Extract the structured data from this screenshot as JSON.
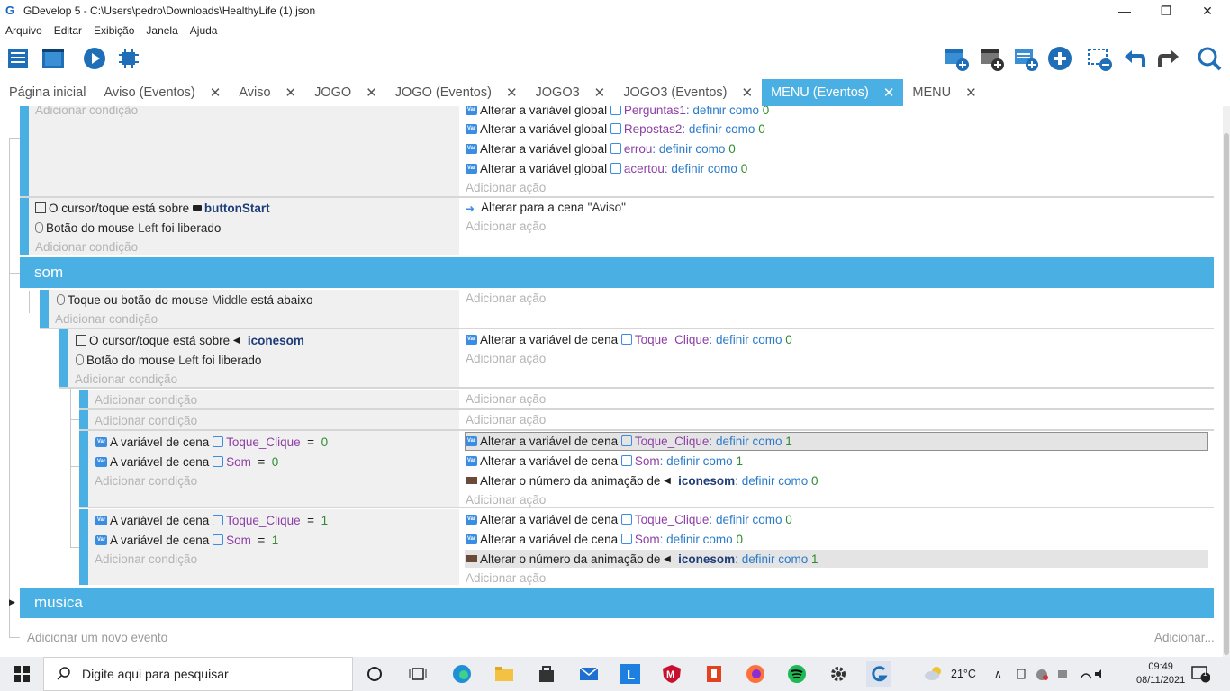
{
  "window": {
    "title": "GDevelop 5 - C:\\Users\\pedro\\Downloads\\HealthyLife (1).json",
    "minimize_glyph": "—",
    "restore_glyph": "❐",
    "close_glyph": "✕"
  },
  "menu": [
    "Arquivo",
    "Editar",
    "Exibição",
    "Janela",
    "Ajuda"
  ],
  "toolbar": {
    "icons": [
      "project-manager-icon",
      "scene-editor-icon",
      "preview-icon",
      "debugger-icon",
      "add-event-icon",
      "add-subevent-icon",
      "add-comment-icon",
      "add-other-icon",
      "delete-icon",
      "undo-icon",
      "redo-icon",
      "search-icon"
    ]
  },
  "tabs": [
    {
      "label": "Página inicial",
      "closable": false,
      "active": false
    },
    {
      "label": "Aviso (Eventos)",
      "closable": true,
      "active": false
    },
    {
      "label": "Aviso",
      "closable": true,
      "active": false
    },
    {
      "label": "JOGO",
      "closable": true,
      "active": false
    },
    {
      "label": "JOGO (Eventos)",
      "closable": true,
      "active": false
    },
    {
      "label": "JOGO3",
      "closable": true,
      "active": false
    },
    {
      "label": "JOGO3 (Eventos)",
      "closable": true,
      "active": false
    },
    {
      "label": "MENU (Eventos)",
      "closable": true,
      "active": true
    },
    {
      "label": "MENU",
      "closable": true,
      "active": false
    }
  ],
  "tab_close_glyph": "✕",
  "events": {
    "add_condition": "Adicionar condição",
    "add_action": "Adicionar ação",
    "add_new_event": "Adicionar um novo evento",
    "add_more": "Adicionar...",
    "set_as": "definir como",
    "e1": {
      "actions": [
        {
          "prefix": "Alterar a variável global",
          "var": "Perguntas1",
          "value": "0"
        },
        {
          "prefix": "Alterar a variável global",
          "var": "Repostas2",
          "value": "0"
        },
        {
          "prefix": "Alterar a variável global",
          "var": "errou",
          "value": "0"
        },
        {
          "prefix": "Alterar a variável global",
          "var": "acertou",
          "value": "0"
        }
      ]
    },
    "e2": {
      "cond1_prefix": "O cursor/toque está sobre",
      "cond1_obj": "buttonStart",
      "cond2_prefix": "Botão do mouse",
      "cond2_button": "Left",
      "cond2_suffix": "foi liberado",
      "action_prefix": "Alterar para a cena",
      "action_scene": "\"Aviso\""
    },
    "group_som": "som",
    "e3": {
      "cond_prefix": "Toque ou botão do mouse",
      "cond_button": "Middle",
      "cond_suffix": "está abaixo"
    },
    "e4": {
      "cond1_prefix": "O cursor/toque está sobre",
      "cond1_obj": "iconesom",
      "cond2_prefix": "Botão do mouse",
      "cond2_button": "Left",
      "cond2_suffix": "foi liberado",
      "action_prefix": "Alterar a variável de cena",
      "action_var": "Toque_Clique",
      "action_value": "0"
    },
    "e7": {
      "conds": [
        {
          "prefix": "A variável de cena",
          "var": "Toque_Clique",
          "op": "=",
          "value": "0"
        },
        {
          "prefix": "A variável de cena",
          "var": "Som",
          "op": "=",
          "value": "0"
        }
      ],
      "actions": [
        {
          "prefix": "Alterar a variável de cena",
          "var": "Toque_Clique",
          "value": "1"
        },
        {
          "prefix": "Alterar a variável de cena",
          "var": "Som",
          "value": "1"
        },
        {
          "prefix": "Alterar o número da animação de",
          "obj": "iconesom",
          "value": "0"
        }
      ]
    },
    "e8": {
      "conds": [
        {
          "prefix": "A variável de cena",
          "var": "Toque_Clique",
          "op": "=",
          "value": "1"
        },
        {
          "prefix": "A variável de cena",
          "var": "Som",
          "op": "=",
          "value": "1"
        }
      ],
      "actions": [
        {
          "prefix": "Alterar a variável de cena",
          "var": "Toque_Clique",
          "value": "0"
        },
        {
          "prefix": "Alterar a variável de cena",
          "var": "Som",
          "value": "0"
        },
        {
          "prefix": "Alterar o número da animação de",
          "obj": "iconesom",
          "value": "1"
        }
      ]
    },
    "group_musica": "musica"
  },
  "taskbar": {
    "search_placeholder": "Digite aqui para pesquisar",
    "weather": "21°C",
    "time": "09:49",
    "date": "08/11/2021",
    "notification_count": "1"
  },
  "colors": {
    "accent": "#4ab0e4",
    "variable": "#8e3fa6",
    "keyword": "#2b7bc9",
    "number": "#2e8b2e"
  }
}
